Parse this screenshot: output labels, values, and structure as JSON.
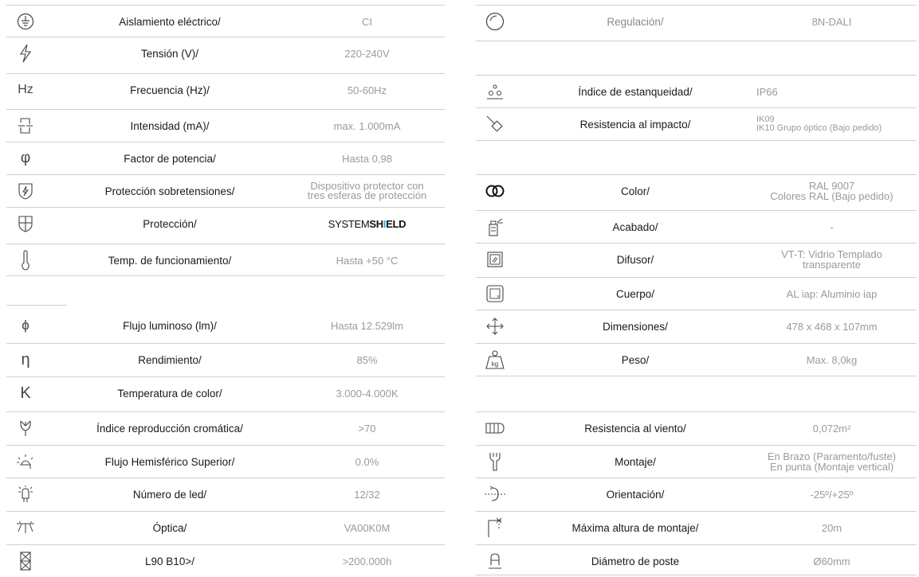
{
  "left": [
    {
      "icon": "ground-icon",
      "label": "Aislamiento eléctrico/",
      "value": "CI"
    },
    {
      "icon": "lightning-icon",
      "label": "Tensión (V)/",
      "value": "220-240V"
    },
    {
      "icon": "hz-icon",
      "icon_text": "Hz",
      "label": "Frecuencia (Hz)/",
      "value": "50-60Hz"
    },
    {
      "icon": "current-icon",
      "label": "Intensidad (mA)/",
      "value": "max. 1.000mA"
    },
    {
      "icon": "phi-icon",
      "icon_text": "φ",
      "label": "Factor de potencia/",
      "value": "Hasta 0,98"
    },
    {
      "icon": "surge-shield-icon",
      "label": "Protección sobretensiones/",
      "value": "Dispositivo protector con\ntres esferas de protección"
    },
    {
      "icon": "shield-icon",
      "label": "Protección/",
      "value": ""
    },
    {
      "icon": "thermometer-icon",
      "label": "Temp. de funcionamiento/",
      "value": "Hasta +50 °C"
    },
    {
      "icon": "flux-icon",
      "icon_text": "ϕ",
      "label": "Flujo luminoso (lm)/",
      "value": "Hasta 12.529lm"
    },
    {
      "icon": "eta-icon",
      "icon_text": "η",
      "label": "Rendimiento/",
      "value": "85%"
    },
    {
      "icon": "kelvin-icon",
      "icon_text": "K",
      "label": "Temperatura de color/",
      "value": "3.000-4.000K"
    },
    {
      "icon": "cri-icon",
      "label": "Índice reproducción cromática/",
      "value": ">70"
    },
    {
      "icon": "uplight-icon",
      "label": "Flujo Hemisférico Superior/",
      "value": "0.0%"
    },
    {
      "icon": "led-icon",
      "label": "Número de led/",
      "value": "12/32"
    },
    {
      "icon": "optic-icon",
      "label": "Óptica/",
      "value": "VA00K0M"
    },
    {
      "icon": "hourglass-icon",
      "label": "L90 B10>/",
      "value": ">200.000h"
    }
  ],
  "brand": {
    "prefix": "SYSTEM",
    "bold": "SH",
    "accent": "I",
    "suffix": "ELD"
  },
  "right": [
    {
      "icon": "dimming-icon",
      "label": "Regulación/",
      "value": "8N-DALI"
    },
    {
      "icon": "ip-icon",
      "label": "Índice de estanqueidad/",
      "value": "IP66"
    },
    {
      "icon": "impact-icon",
      "label": "Resistencia al impacto/",
      "value": "IK09\nIK10 Grupo óptico (Bajo pedido)"
    },
    {
      "icon": "color-icon",
      "label": "Color/",
      "value": "RAL 9007\nColores RAL (Bajo pedido)"
    },
    {
      "icon": "spray-icon",
      "label": "Acabado/",
      "value": "-"
    },
    {
      "icon": "diffuser-icon",
      "label": "Difusor/",
      "value": "VT-T: Vidrio Templado\ntransparente"
    },
    {
      "icon": "body-icon",
      "label": "Cuerpo/",
      "value": "AL iap: Aluminio iap"
    },
    {
      "icon": "dimensions-icon",
      "label": "Dimensiones/",
      "value": "478 x 468 x 107mm"
    },
    {
      "icon": "weight-icon",
      "label": "Peso/",
      "value": "Max. 8,0kg",
      "icon_text": "kg"
    },
    {
      "icon": "wind-icon",
      "label": "Resistencia al viento/",
      "value": "0,072m²"
    },
    {
      "icon": "wrench-icon",
      "label": "Montaje/",
      "value": "En Brazo (Paramento/fuste)\nEn punta (Montaje vertical)"
    },
    {
      "icon": "orientation-icon",
      "label": "Orientación/",
      "value": "-25º/+25º"
    },
    {
      "icon": "height-icon",
      "label": "Máxima altura de montaje/",
      "value": "20m"
    },
    {
      "icon": "pole-icon",
      "label": "Diámetro de poste",
      "value": "Ø60mm"
    }
  ]
}
